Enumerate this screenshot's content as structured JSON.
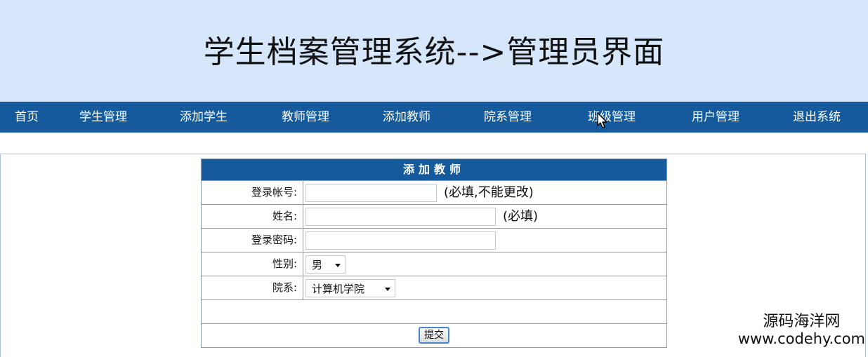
{
  "header": {
    "title": "学生档案管理系统-->管理员界面"
  },
  "nav": {
    "items": [
      {
        "label": "首页"
      },
      {
        "label": "学生管理"
      },
      {
        "label": "添加学生"
      },
      {
        "label": "教师管理"
      },
      {
        "label": "添加教师"
      },
      {
        "label": "院系管理"
      },
      {
        "label": "班级管理"
      },
      {
        "label": "用户管理"
      },
      {
        "label": "退出系统"
      }
    ]
  },
  "form": {
    "title": "添加教师",
    "fields": {
      "account": {
        "label": "登录帐号:",
        "value": "",
        "hint": "(必填,不能更改)"
      },
      "name": {
        "label": "姓名:",
        "value": "",
        "hint": "(必填)"
      },
      "password": {
        "label": "登录密码:",
        "value": ""
      },
      "gender": {
        "label": "性别:",
        "selected": "男"
      },
      "department": {
        "label": "院系:",
        "selected": "计算机学院"
      }
    },
    "submit_label": "提交"
  },
  "watermark": {
    "line1": "源码海洋网",
    "line2": "www.codehy.com"
  },
  "colors": {
    "header_bg": "#d6e6fb",
    "nav_bg": "#155a9c",
    "table_title_bg": "#155a9c"
  }
}
